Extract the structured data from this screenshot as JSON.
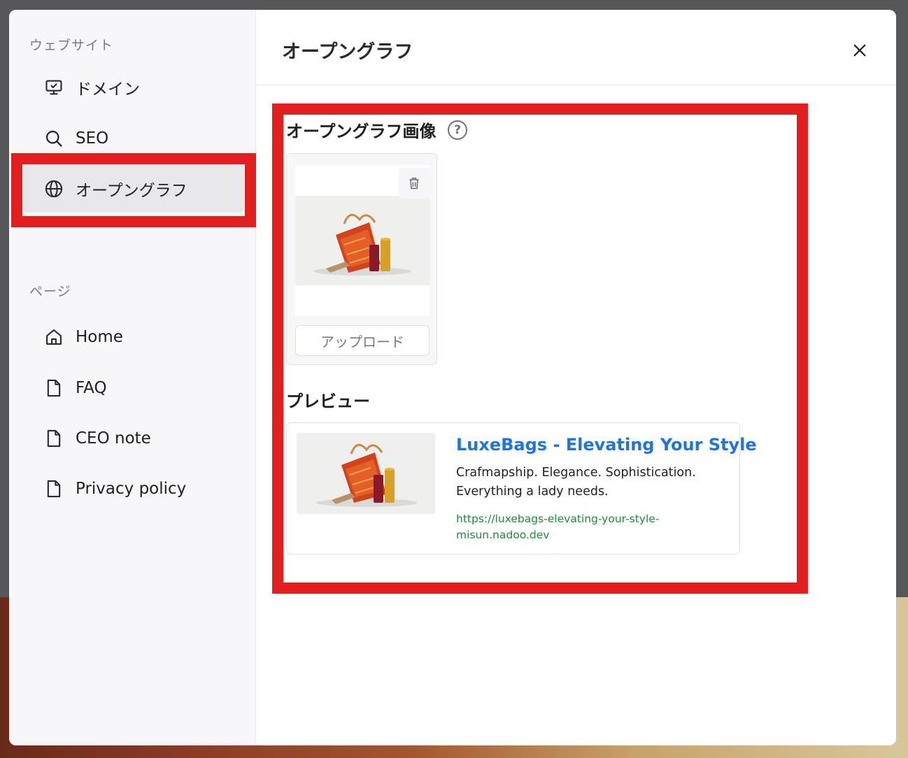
{
  "sidebar": {
    "website_heading": "ウェブサイト",
    "website_items": [
      {
        "label": "ドメイン",
        "icon": "monitor-icon"
      },
      {
        "label": "SEO",
        "icon": "search-icon"
      },
      {
        "label": "オープングラフ",
        "icon": "globe-icon",
        "active": true
      }
    ],
    "pages_heading": "ページ",
    "page_items": [
      {
        "label": "Home",
        "icon": "home-icon"
      },
      {
        "label": "FAQ",
        "icon": "file-icon"
      },
      {
        "label": "CEO note",
        "icon": "file-icon"
      },
      {
        "label": "Privacy policy",
        "icon": "file-icon"
      }
    ]
  },
  "header": {
    "title": "オープングラフ"
  },
  "og_image": {
    "label": "オープングラフ画像",
    "help": "?",
    "upload_label": "アップロード"
  },
  "preview": {
    "label": "プレビュー",
    "title": "LuxeBags - Elevating Your Style",
    "description_line1": "Crafmapship. Elegance. Sophistication.",
    "description_line2": "Everything a lady needs.",
    "url_line1": "https://luxebags-elevating-your-style-",
    "url_line2": "misun.nadoo.dev"
  },
  "colors": {
    "highlight_red": "#e31e1e",
    "link_blue": "#1f74e0",
    "url_green": "#1f8a3c"
  }
}
